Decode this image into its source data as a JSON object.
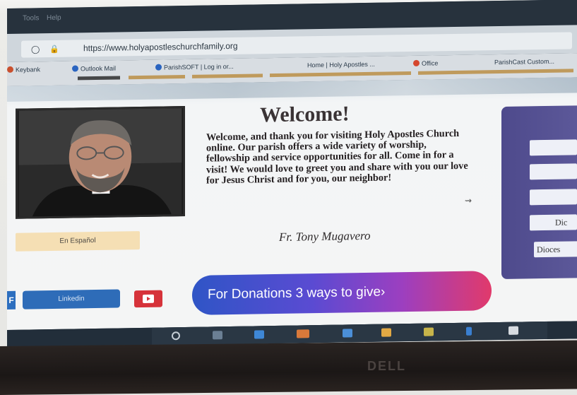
{
  "browser": {
    "menu": [
      "Tools",
      "Help"
    ],
    "url": "https://www.holyapostleschurchfamily.org",
    "bookmarks": [
      "Keybank",
      "Outlook Mail",
      "ParishSOFT | Log in or...",
      "Home | Holy Apostles ...",
      "Office",
      "ParishCast Custom..."
    ]
  },
  "page": {
    "welcome_title": "Welcome!",
    "welcome_body": "Welcome, and thank you for visiting Holy Apostles Church online.  Our parish offers a wide variety of worship, fellowship and service opportunities for all.  Come in for a  visit!  We would love to greet you and share with you our love for Jesus Christ and for you, our neighbor!",
    "signature": "Fr. Tony Mugavero",
    "espanol_button": "En Español",
    "linkedin_button": "Linkedin",
    "facebook_glyph": "F",
    "donations_button": "For Donations 3 ways to give›",
    "side_buttons": [
      "",
      "",
      "",
      "Dic",
      "Dioces"
    ]
  },
  "device": {
    "brand": "DELL"
  },
  "colors": {
    "donate_start": "#2f55c6",
    "donate_end": "#e13a6b",
    "side_panel": "#4e4a8c",
    "linkedin": "#2e6cb8",
    "youtube": "#d6333a",
    "espanol": "#f5dfb4"
  }
}
